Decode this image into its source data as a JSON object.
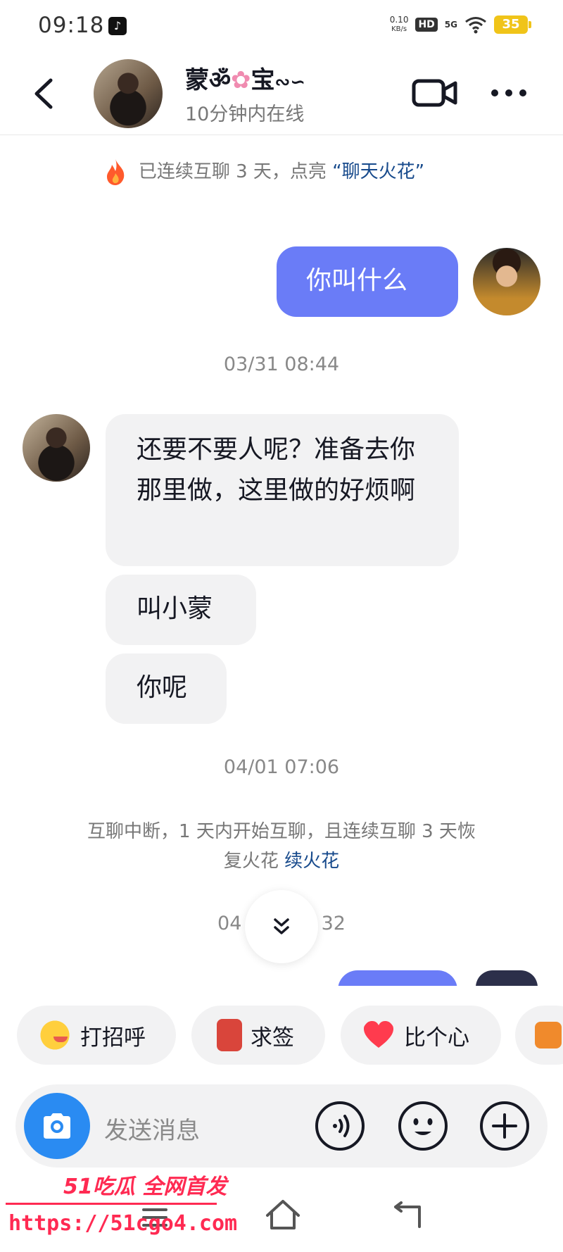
{
  "status_bar": {
    "time": "09:18",
    "net_speed_value": "0.10",
    "net_speed_unit": "KB/s",
    "hd": "HD",
    "signal": "5G",
    "battery": "35"
  },
  "header": {
    "contact_name_prefix": "蒙",
    "contact_name_suffix": "宝",
    "contact_status": "10分钟内在线"
  },
  "spark_notice": {
    "text": "已连续互聊 3 天，点亮 ",
    "link": "“聊天火花”"
  },
  "messages": [
    {
      "direction": "out",
      "text": "你叫什么"
    },
    {
      "timestamp": "03/31 08:44"
    },
    {
      "direction": "in",
      "text": "还要不要人呢？准备去你那里做，这里做的好烦啊"
    },
    {
      "direction": "in",
      "text": "叫小蒙"
    },
    {
      "direction": "in",
      "text": "你呢"
    },
    {
      "timestamp": "04/01 07:06"
    }
  ],
  "system_notice": {
    "text": "互聊中断，1 天内开始互聊，且连续互聊 3 天恢复火花 ",
    "link": "续火花"
  },
  "partial_timestamp": {
    "left": "04",
    "right": "32"
  },
  "quick_replies": [
    {
      "label": "打招呼",
      "icon": "wave-emoji-icon"
    },
    {
      "label": "求签",
      "icon": "fortune-sign-icon"
    },
    {
      "label": "比个心",
      "icon": "heart-icon"
    }
  ],
  "input": {
    "placeholder": "发送消息"
  },
  "watermark": {
    "title": "51吃瓜 全网首发",
    "url": "https://51cgo4.com"
  },
  "colors": {
    "outgoing_bubble": "#6a7cf7",
    "incoming_bubble": "#f2f2f3",
    "link": "#174a8c",
    "camera_button": "#2a8bf2",
    "watermark": "#ff2a52"
  }
}
